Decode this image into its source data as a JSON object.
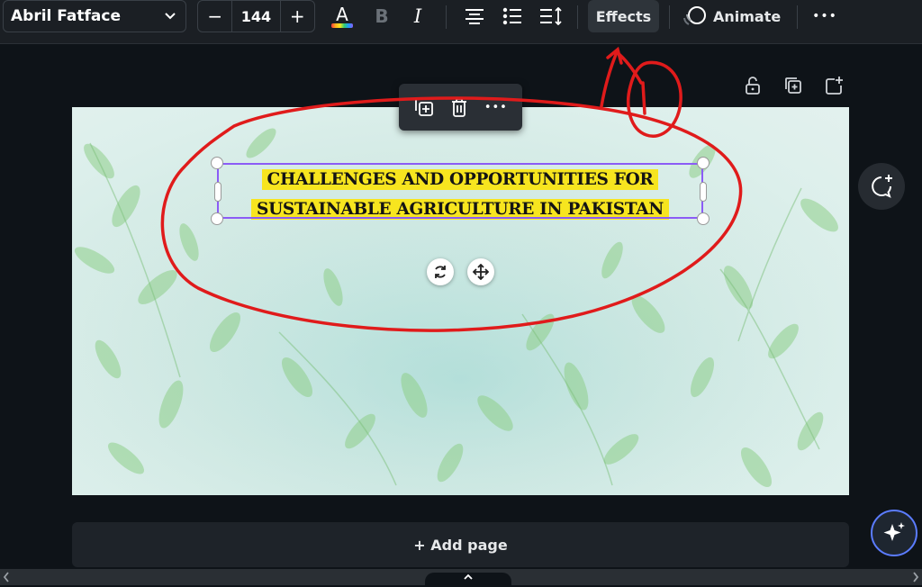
{
  "toolbar": {
    "font_family": "Abril Fatface",
    "font_size": "144",
    "decrease_label": "−",
    "increase_label": "+",
    "text_color_letter": "A",
    "bold_label": "B",
    "italic_label": "I",
    "effects_label": "Effects",
    "animate_label": "Animate",
    "more_label": "•••"
  },
  "canvas": {
    "headline_line1": "CHALLENGES AND OPPORTUNITIES FOR",
    "headline_line2": "SUSTAINABLE AGRICULTURE IN PAKISTAN",
    "highlight_color": "#f7e51f",
    "background_color": "#cfe8e2"
  },
  "floating_toolbar": {
    "more_label": "•••"
  },
  "page": {
    "add_page_label": "+ Add page"
  },
  "colors": {
    "accent_selection": "#8b5cf6",
    "annotation_red": "#e01b1b",
    "toolbar_bg": "#1b1f24"
  },
  "icons": [
    "chevron-down-icon",
    "text-color-icon",
    "bold-icon",
    "italic-icon",
    "align-center-icon",
    "list-icon",
    "line-spacing-icon",
    "animate-icon",
    "more-icon",
    "lock-icon",
    "duplicate-page-icon",
    "add-page-icon",
    "copy-icon",
    "trash-icon",
    "rotate-icon",
    "move-icon",
    "comment-add-icon",
    "magic-sparkle-icon",
    "chevron-up-icon"
  ]
}
